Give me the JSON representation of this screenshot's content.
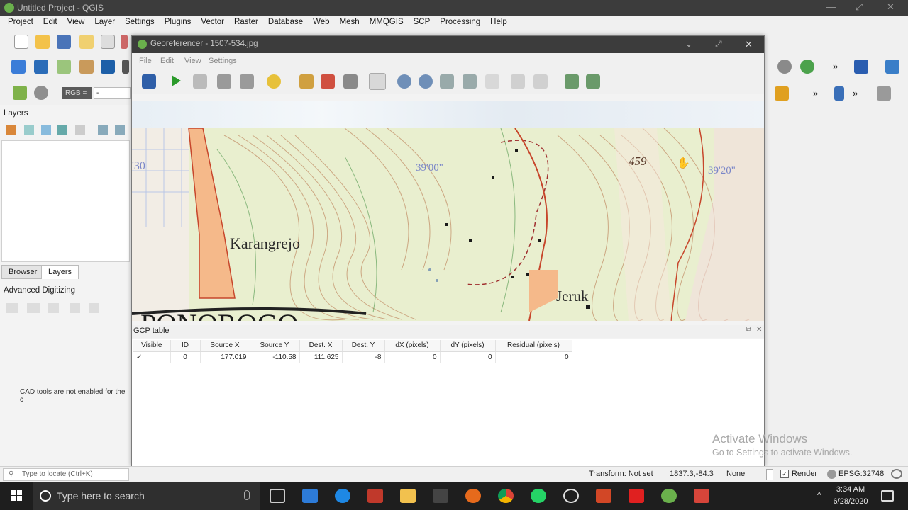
{
  "app": {
    "title": "Untitled Project - QGIS"
  },
  "menubar": [
    "Project",
    "Edit",
    "View",
    "Layer",
    "Settings",
    "Plugins",
    "Vector",
    "Raster",
    "Database",
    "Web",
    "Mesh",
    "MMQGIS",
    "SCP",
    "Processing",
    "Help"
  ],
  "toolbar": {
    "rgb_label": "RGB =",
    "rgb_value": "-"
  },
  "left_panel": {
    "layers_title": "Layers",
    "tabs": [
      "Browser",
      "Layers"
    ],
    "advanced_title": "Advanced Digitizing",
    "cad_message": "CAD tools are not enabled for the c"
  },
  "georeferencer": {
    "title": "Georeferencer - 1507-534.jpg",
    "menu": [
      "File",
      "Edit",
      "View",
      "Settings"
    ],
    "map_labels": {
      "town1": "Karangrejo",
      "town2": "Jeruk",
      "elev": "459",
      "coord1": "39'00\"",
      "coord2": "39'20\"",
      "coord3": "'30",
      "big": "PONOROGO"
    },
    "gcp": {
      "title": "GCP table",
      "columns": [
        "Visible",
        "ID",
        "Source X",
        "Source Y",
        "Dest. X",
        "Dest. Y",
        "dX (pixels)",
        "dY (pixels)",
        "Residual (pixels)"
      ],
      "rows": [
        {
          "visible": "✓",
          "id": "0",
          "src_x": "177.019",
          "src_y": "-110.58",
          "dst_x": "111.625",
          "dst_y": "-8",
          "dx": "0",
          "dy": "0",
          "res": "0"
        }
      ]
    }
  },
  "status": {
    "locate_placeholder": "Type to locate (Ctrl+K)",
    "transform": "Transform: Not set",
    "coords": "1837.3,-84.3",
    "none": "None",
    "render": "Render",
    "epsg": "EPSG:32748"
  },
  "watermark": {
    "line1": "Activate Windows",
    "line2": "Go to Settings to activate Windows."
  },
  "taskbar": {
    "search": "Type here to search",
    "time": "3:34 AM",
    "date": "6/28/2020"
  },
  "colors": {
    "title_bg": "#3c3c3c",
    "taskbar_bg": "#1e1e1e",
    "qgis_green": "#6ab04c"
  }
}
